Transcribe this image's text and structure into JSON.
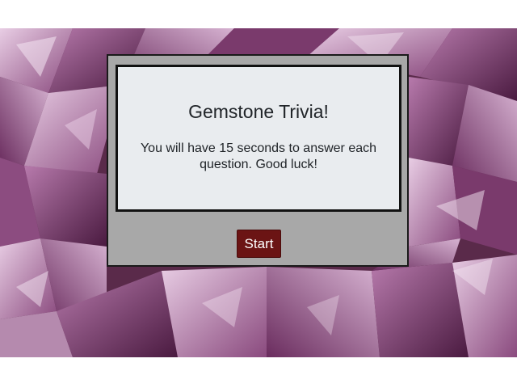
{
  "game": {
    "title": "Gemstone Trivia!",
    "instructions": "You will have 15 seconds to answer each question. Good luck!",
    "start_label": "Start"
  },
  "background": {
    "image": "amethyst-crystals",
    "colors": {
      "base": "#5a2a4a",
      "light_crystal": "#c9a2c4",
      "mid_crystal": "#9a5a8c",
      "dark_crystal": "#3a1530"
    }
  },
  "colors": {
    "panel": "#a8a8a8",
    "card": "#e9ecef",
    "button": "#6b1414",
    "text": "#212529"
  }
}
